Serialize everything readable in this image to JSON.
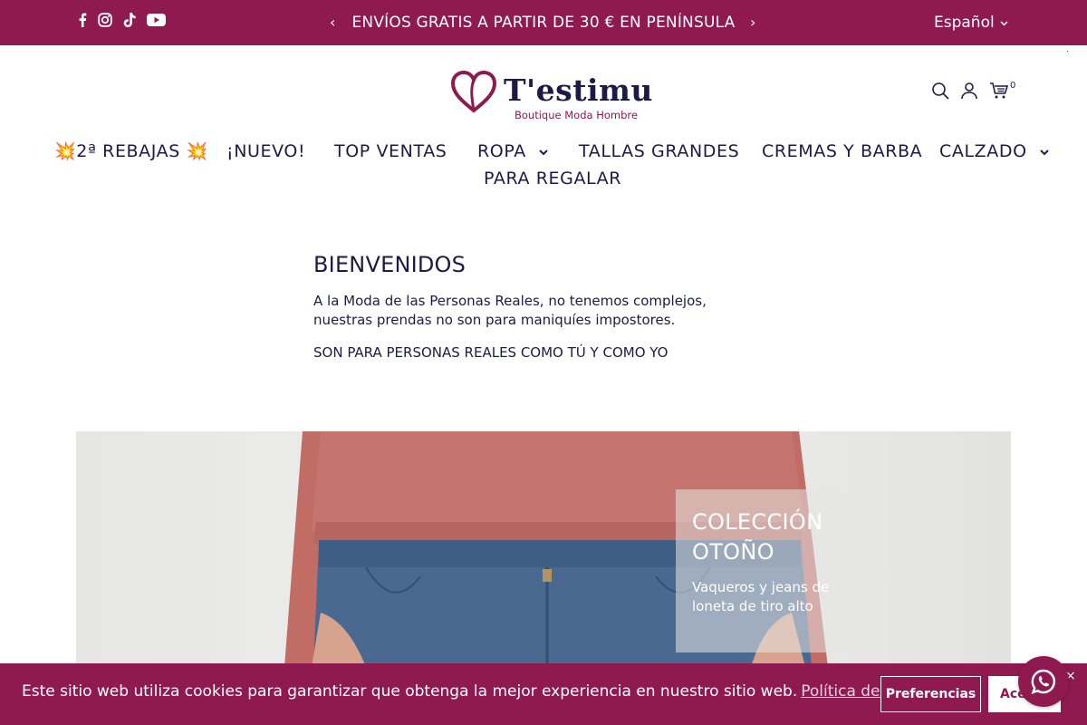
{
  "topbar": {
    "announcement": "ENVÍOS GRATIS A PARTIR DE 30 € EN PENÍNSULA",
    "prev_arrow": "‹",
    "next_arrow": "›",
    "language": "Español",
    "social_icons": [
      "facebook-icon",
      "instagram-icon",
      "tiktok-icon",
      "youtube-icon"
    ]
  },
  "header": {
    "logo_text": "T'estimu",
    "logo_subtitle": "Boutique Moda Hombre",
    "cart_count": "0",
    "icons": [
      "search-icon",
      "account-icon",
      "cart-icon"
    ]
  },
  "nav": {
    "items": [
      {
        "label": "💥2ª REBAJAS 💥"
      },
      {
        "label": "¡NUEVO!"
      },
      {
        "label": "TOP VENTAS"
      },
      {
        "label": "ROPA"
      },
      {
        "label": "TALLAS GRANDES"
      },
      {
        "label": "CREMAS Y BARBA"
      },
      {
        "label": "CALZADO"
      },
      {
        "label": "PARA REGALAR"
      }
    ]
  },
  "welcome": {
    "title": "BIENVENIDOS",
    "paragraph1": "A la Moda de las Personas Reales, no tenemos complejos, nuestras prendas no son para maniquíes impostores.",
    "paragraph2": "SON PARA PERSONAS REALES COMO TÚ Y COMO YO"
  },
  "hero": {
    "title": "COLECCIÓN OTOÑO",
    "subtitle": "Vaqueros y jeans de loneta de tiro alto"
  },
  "cookie": {
    "text": "Este sitio web utiliza cookies para garantizar que obtenga la mejor experiencia en nuestro sitio web.",
    "link": "Política de Privacidad",
    "preferences_label": "Preferencias",
    "accept_label": "Aceptar",
    "close": "×"
  },
  "colors": {
    "brand": "#8e1a4f",
    "navy": "#1d1b45",
    "white": "#ffffff"
  }
}
